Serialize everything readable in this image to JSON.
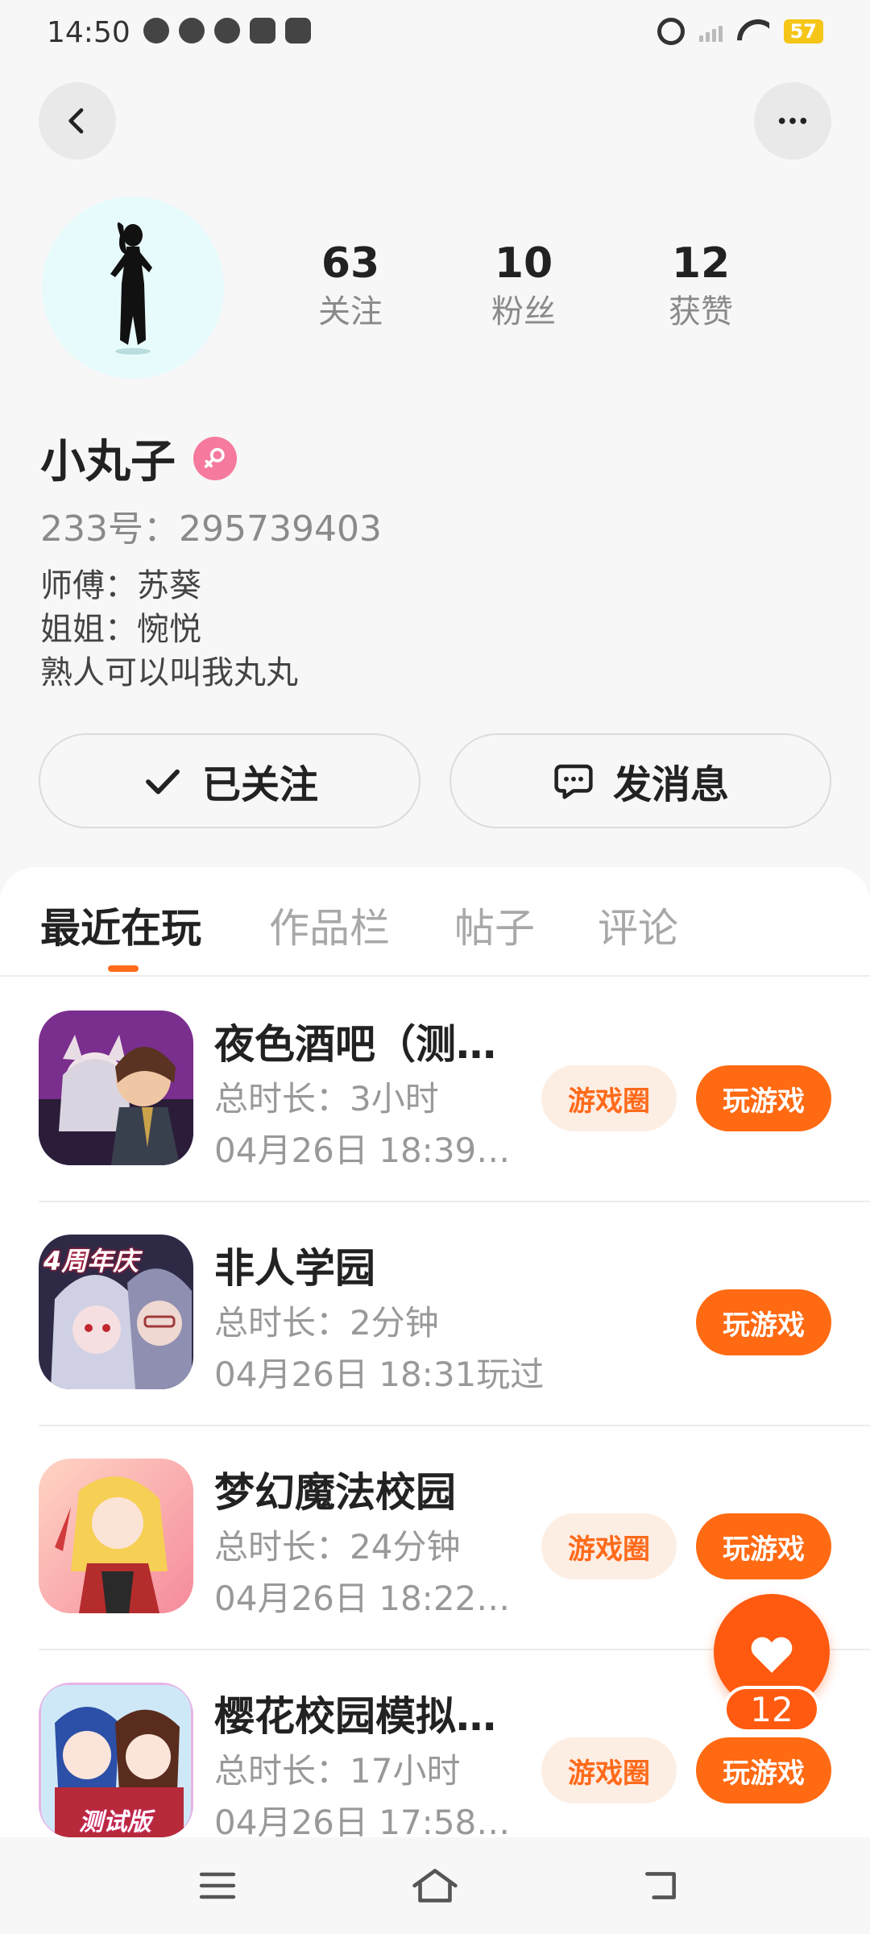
{
  "status_bar": {
    "time": "14:50",
    "battery": "57"
  },
  "header": {
    "back_icon": "chevron-left-icon",
    "more_icon": "more-horizontal-icon"
  },
  "profile": {
    "stats": [
      {
        "value": "63",
        "label": "关注"
      },
      {
        "value": "10",
        "label": "粉丝"
      },
      {
        "value": "12",
        "label": "获赞"
      }
    ],
    "name": "小丸子",
    "gender_icon": "female-icon",
    "id_line": "233号：295739403",
    "bio_lines": [
      "师傅：苏葵",
      "姐姐：惋悦",
      "熟人可以叫我丸丸"
    ]
  },
  "actions": {
    "follow_label": "已关注",
    "message_label": "发消息"
  },
  "tabs": [
    "最近在玩",
    "作品栏",
    "帖子",
    "评论"
  ],
  "games": [
    {
      "title": "夜色酒吧（测…",
      "duration": "总时长：3小时",
      "last_played": "04月26日 18:39…",
      "circle_label": "游戏圈",
      "play_label": "玩游戏",
      "has_circle": true
    },
    {
      "title": "非人学园",
      "duration": "总时长：2分钟",
      "last_played": "04月26日 18:31玩过",
      "circle_label": "",
      "play_label": "玩游戏",
      "has_circle": false
    },
    {
      "title": "梦幻魔法校园",
      "duration": "总时长：24分钟",
      "last_played": "04月26日 18:22…",
      "circle_label": "游戏圈",
      "play_label": "玩游戏",
      "has_circle": true
    },
    {
      "title": "樱花校园模拟…",
      "duration": "总时长：17小时",
      "last_played": "04月26日 17:58…",
      "circle_label": "游戏圈",
      "play_label": "玩游戏",
      "has_circle": true
    }
  ],
  "game_icon_texts": {
    "anniversary": "4周年庆",
    "test_version": "测试版"
  },
  "like": {
    "count": "12"
  },
  "colors": {
    "accent": "#ff6a13",
    "accent_light": "#fdeee4",
    "gender_pink": "#f57a9d"
  }
}
